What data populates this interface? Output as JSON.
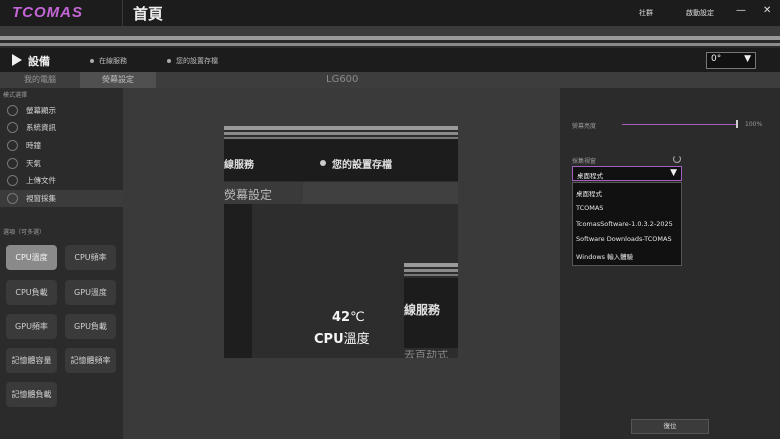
{
  "app": {
    "logo": "TCOMAS",
    "page_title": "首頁",
    "community": "社群",
    "startup_settings": "啟動設定",
    "minimize_glyph": "—",
    "close_glyph": "✕"
  },
  "devicebar": {
    "label": "設備",
    "online_status": "在線服務",
    "saved_settings": "您的設置存檔",
    "rotation_value": "0°",
    "rotation_arrow": "▼"
  },
  "tabs": [
    {
      "label": "我的電腦",
      "active": false
    },
    {
      "label": "熒幕設定",
      "active": true
    }
  ],
  "device_name": "LG600",
  "left": {
    "mode_section": "模式選擇",
    "modes": [
      {
        "label": "螢幕顯示",
        "icon": "monitor-icon"
      },
      {
        "label": "系統資訊",
        "icon": "info-icon"
      },
      {
        "label": "時鐘",
        "icon": "clock-icon"
      },
      {
        "label": "天氣",
        "icon": "weather-icon"
      },
      {
        "label": "上傳文件",
        "icon": "upload-icon"
      },
      {
        "label": "視窗採集",
        "icon": "capture-icon",
        "selected": true
      }
    ],
    "options_section": "選項（可多選）",
    "options": [
      {
        "label": "CPU溫度",
        "selected": true
      },
      {
        "label": "CPU頻率"
      },
      {
        "label": "CPU負載"
      },
      {
        "label": "GPU溫度"
      },
      {
        "label": "GPU頻率"
      },
      {
        "label": "GPU負載"
      },
      {
        "label": "記憶體容量"
      },
      {
        "label": "記憶體頻率"
      },
      {
        "label": "記憶體負載"
      }
    ]
  },
  "preview": {
    "online": "線服務",
    "saved": "您的設置存檔",
    "screen_settings": "熒幕設定",
    "temp_value": "42",
    "temp_unit": "℃",
    "metric_prefix": "CPU",
    "metric_suffix": "溫度",
    "online2": "線服務",
    "cut_text": "去首劫式"
  },
  "right": {
    "brightness_label": "熒幕亮度",
    "brightness_value": "100%",
    "brightness_level": 1.0,
    "capture_label": "採集視窗",
    "selected_window": "桌面程式",
    "dropdown_arrow": "▼",
    "window_options": [
      "桌面程式",
      "TCOMAS",
      "TcomasSoftware-1.0.3.2-2025",
      "Software Downloads-TCOMAS",
      "Windows 輸入體驗"
    ],
    "reset_label": "復位"
  },
  "colors": {
    "accent": "#a35fc0",
    "logo": "#c466d6"
  }
}
